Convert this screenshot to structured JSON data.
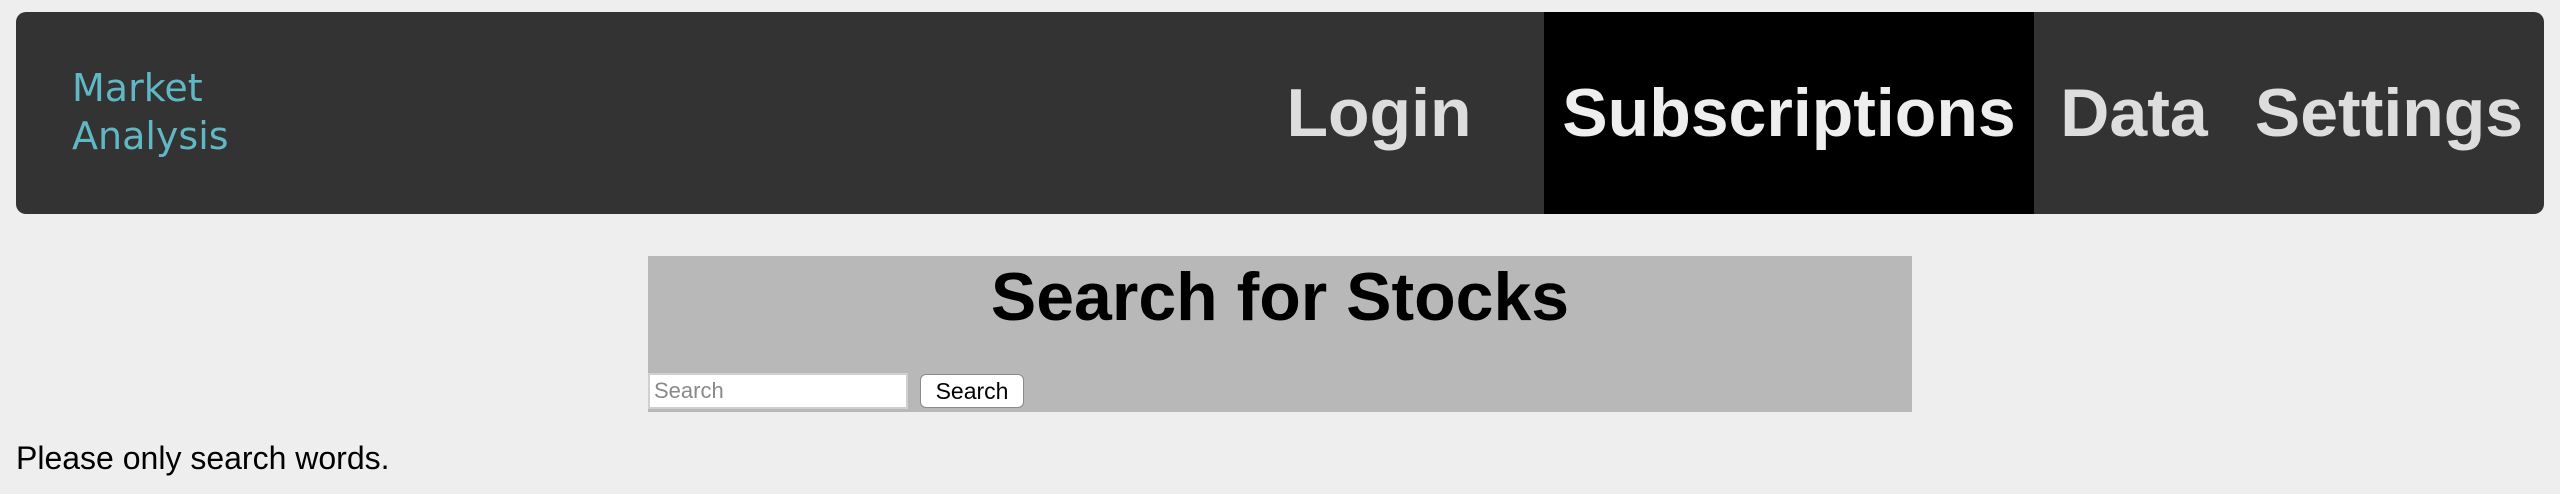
{
  "brand": {
    "line1": "Market",
    "line2": "Analysis"
  },
  "nav": {
    "items": [
      {
        "label": "Login",
        "active": false
      },
      {
        "label": "Subscriptions",
        "active": true
      },
      {
        "label": "Data",
        "active": false
      },
      {
        "label": "Settings",
        "active": false
      }
    ]
  },
  "search": {
    "title": "Search for Stocks",
    "placeholder": "Search",
    "value": "",
    "button_label": "Search"
  },
  "help_text": "Please only search words.",
  "colors": {
    "navbar_bg": "#333333",
    "brand": "#5fb8c4",
    "active_tab_bg": "#000000",
    "panel_bg": "#b8b8b8",
    "page_bg": "#eeeeee"
  }
}
